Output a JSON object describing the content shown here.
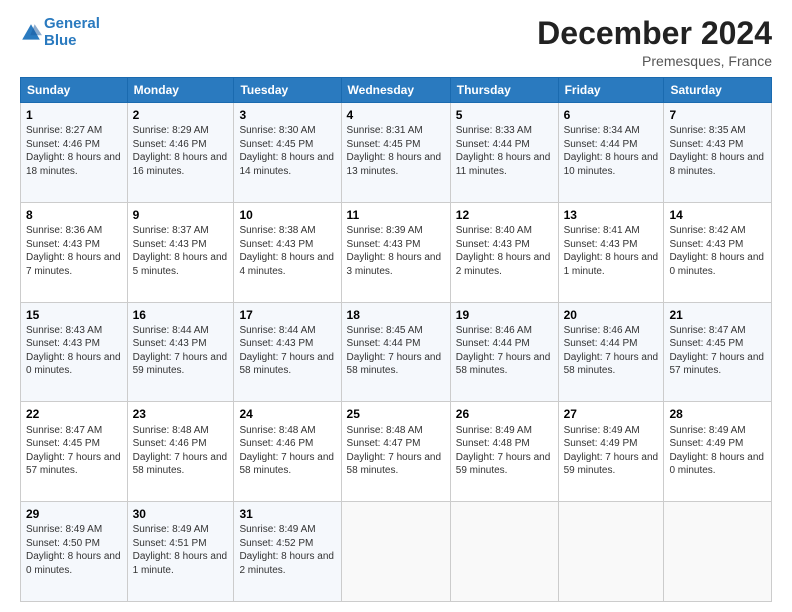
{
  "header": {
    "logo_line1": "General",
    "logo_line2": "Blue",
    "month_title": "December 2024",
    "location": "Premesques, France"
  },
  "days_of_week": [
    "Sunday",
    "Monday",
    "Tuesday",
    "Wednesday",
    "Thursday",
    "Friday",
    "Saturday"
  ],
  "weeks": [
    [
      {
        "day": "1",
        "info": "Sunrise: 8:27 AM\nSunset: 4:46 PM\nDaylight: 8 hours and 18 minutes."
      },
      {
        "day": "2",
        "info": "Sunrise: 8:29 AM\nSunset: 4:46 PM\nDaylight: 8 hours and 16 minutes."
      },
      {
        "day": "3",
        "info": "Sunrise: 8:30 AM\nSunset: 4:45 PM\nDaylight: 8 hours and 14 minutes."
      },
      {
        "day": "4",
        "info": "Sunrise: 8:31 AM\nSunset: 4:45 PM\nDaylight: 8 hours and 13 minutes."
      },
      {
        "day": "5",
        "info": "Sunrise: 8:33 AM\nSunset: 4:44 PM\nDaylight: 8 hours and 11 minutes."
      },
      {
        "day": "6",
        "info": "Sunrise: 8:34 AM\nSunset: 4:44 PM\nDaylight: 8 hours and 10 minutes."
      },
      {
        "day": "7",
        "info": "Sunrise: 8:35 AM\nSunset: 4:43 PM\nDaylight: 8 hours and 8 minutes."
      }
    ],
    [
      {
        "day": "8",
        "info": "Sunrise: 8:36 AM\nSunset: 4:43 PM\nDaylight: 8 hours and 7 minutes."
      },
      {
        "day": "9",
        "info": "Sunrise: 8:37 AM\nSunset: 4:43 PM\nDaylight: 8 hours and 5 minutes."
      },
      {
        "day": "10",
        "info": "Sunrise: 8:38 AM\nSunset: 4:43 PM\nDaylight: 8 hours and 4 minutes."
      },
      {
        "day": "11",
        "info": "Sunrise: 8:39 AM\nSunset: 4:43 PM\nDaylight: 8 hours and 3 minutes."
      },
      {
        "day": "12",
        "info": "Sunrise: 8:40 AM\nSunset: 4:43 PM\nDaylight: 8 hours and 2 minutes."
      },
      {
        "day": "13",
        "info": "Sunrise: 8:41 AM\nSunset: 4:43 PM\nDaylight: 8 hours and 1 minute."
      },
      {
        "day": "14",
        "info": "Sunrise: 8:42 AM\nSunset: 4:43 PM\nDaylight: 8 hours and 0 minutes."
      }
    ],
    [
      {
        "day": "15",
        "info": "Sunrise: 8:43 AM\nSunset: 4:43 PM\nDaylight: 8 hours and 0 minutes."
      },
      {
        "day": "16",
        "info": "Sunrise: 8:44 AM\nSunset: 4:43 PM\nDaylight: 7 hours and 59 minutes."
      },
      {
        "day": "17",
        "info": "Sunrise: 8:44 AM\nSunset: 4:43 PM\nDaylight: 7 hours and 58 minutes."
      },
      {
        "day": "18",
        "info": "Sunrise: 8:45 AM\nSunset: 4:44 PM\nDaylight: 7 hours and 58 minutes."
      },
      {
        "day": "19",
        "info": "Sunrise: 8:46 AM\nSunset: 4:44 PM\nDaylight: 7 hours and 58 minutes."
      },
      {
        "day": "20",
        "info": "Sunrise: 8:46 AM\nSunset: 4:44 PM\nDaylight: 7 hours and 58 minutes."
      },
      {
        "day": "21",
        "info": "Sunrise: 8:47 AM\nSunset: 4:45 PM\nDaylight: 7 hours and 57 minutes."
      }
    ],
    [
      {
        "day": "22",
        "info": "Sunrise: 8:47 AM\nSunset: 4:45 PM\nDaylight: 7 hours and 57 minutes."
      },
      {
        "day": "23",
        "info": "Sunrise: 8:48 AM\nSunset: 4:46 PM\nDaylight: 7 hours and 58 minutes."
      },
      {
        "day": "24",
        "info": "Sunrise: 8:48 AM\nSunset: 4:46 PM\nDaylight: 7 hours and 58 minutes."
      },
      {
        "day": "25",
        "info": "Sunrise: 8:48 AM\nSunset: 4:47 PM\nDaylight: 7 hours and 58 minutes."
      },
      {
        "day": "26",
        "info": "Sunrise: 8:49 AM\nSunset: 4:48 PM\nDaylight: 7 hours and 59 minutes."
      },
      {
        "day": "27",
        "info": "Sunrise: 8:49 AM\nSunset: 4:49 PM\nDaylight: 7 hours and 59 minutes."
      },
      {
        "day": "28",
        "info": "Sunrise: 8:49 AM\nSunset: 4:49 PM\nDaylight: 8 hours and 0 minutes."
      }
    ],
    [
      {
        "day": "29",
        "info": "Sunrise: 8:49 AM\nSunset: 4:50 PM\nDaylight: 8 hours and 0 minutes."
      },
      {
        "day": "30",
        "info": "Sunrise: 8:49 AM\nSunset: 4:51 PM\nDaylight: 8 hours and 1 minute."
      },
      {
        "day": "31",
        "info": "Sunrise: 8:49 AM\nSunset: 4:52 PM\nDaylight: 8 hours and 2 minutes."
      },
      {
        "day": "",
        "info": ""
      },
      {
        "day": "",
        "info": ""
      },
      {
        "day": "",
        "info": ""
      },
      {
        "day": "",
        "info": ""
      }
    ]
  ]
}
